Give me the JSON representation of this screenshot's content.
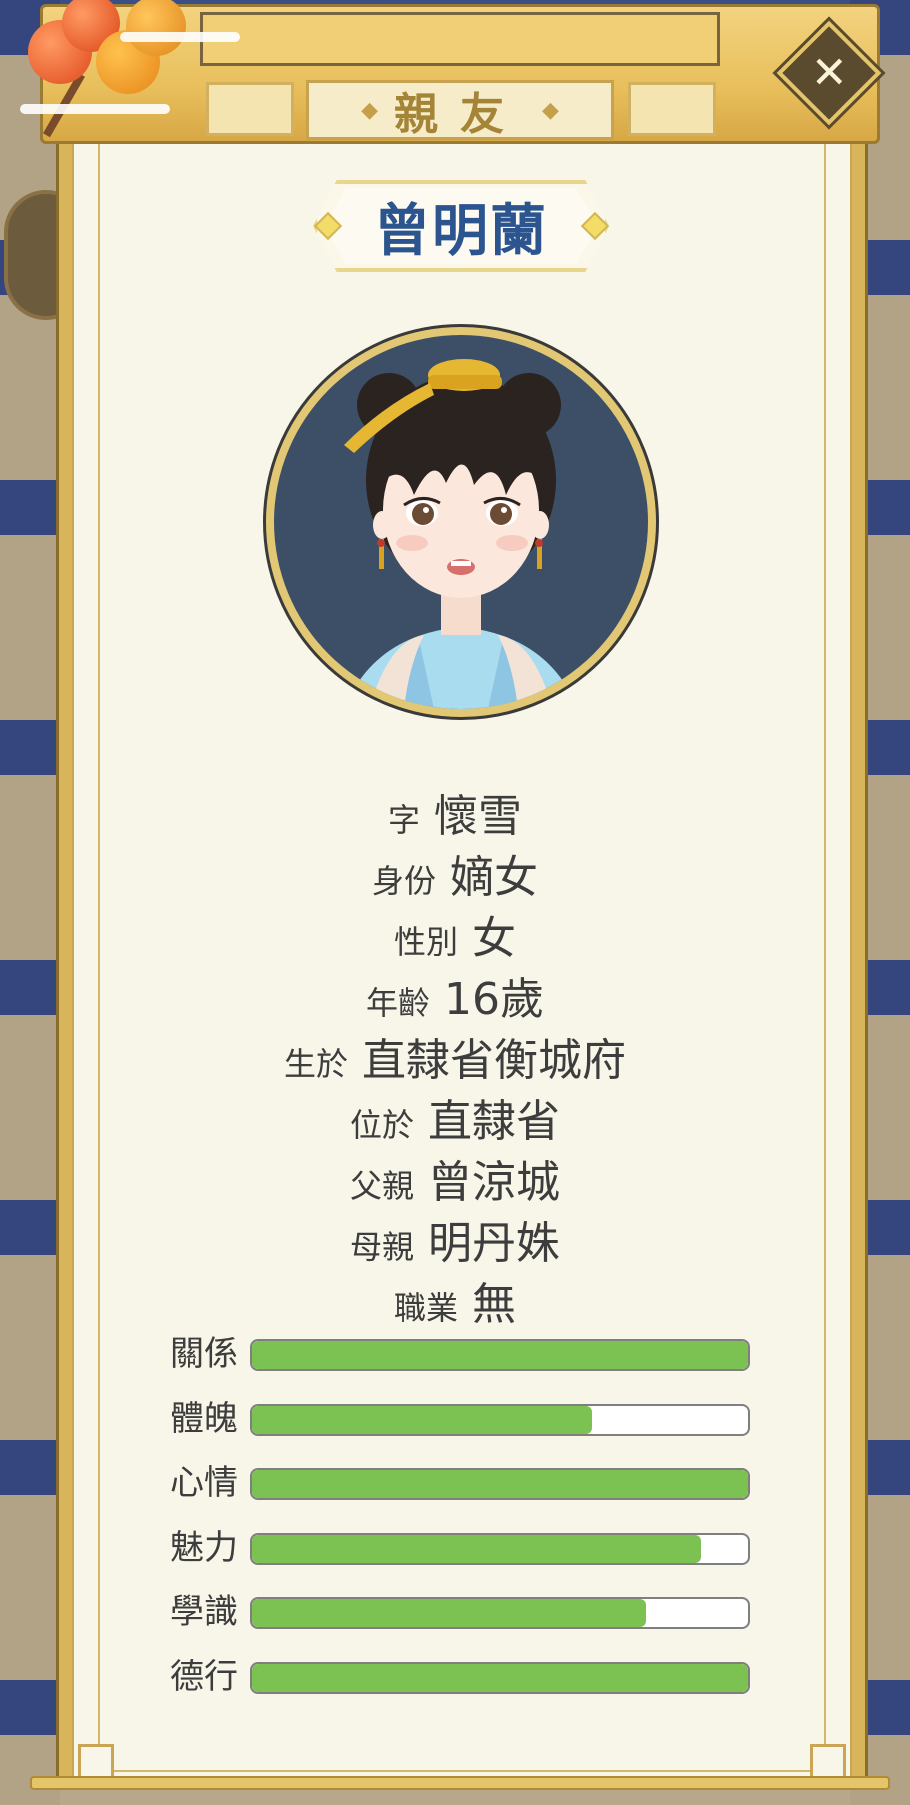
{
  "header": {
    "title": "親友",
    "close_icon": "close-icon"
  },
  "character": {
    "name": "曾明蘭",
    "portrait_icon": "character-portrait"
  },
  "info": [
    {
      "label": "字",
      "value": "懷雪"
    },
    {
      "label": "身份",
      "value": "嫡女"
    },
    {
      "label": "性別",
      "value": "女"
    },
    {
      "label": "年齡",
      "value": "16歲"
    },
    {
      "label": "生於",
      "value": "直隸省衡城府"
    },
    {
      "label": "位於",
      "value": "直隸省"
    },
    {
      "label": "父親",
      "value": "曾涼城"
    },
    {
      "label": "母親",
      "value": "明丹姝"
    },
    {
      "label": "職業",
      "value": "無"
    }
  ],
  "stats": [
    {
      "label": "關係",
      "fill": 1.0
    },
    {
      "label": "體魄",
      "fill": 0.685
    },
    {
      "label": "心情",
      "fill": 1.0
    },
    {
      "label": "魅力",
      "fill": 0.905
    },
    {
      "label": "學識",
      "fill": 0.795
    },
    {
      "label": "德行",
      "fill": 1.0
    }
  ],
  "colors": {
    "bar_fill": "#7cc252",
    "name_text": "#2c5590",
    "title_text": "#a48436",
    "parchment": "#f8f5e9",
    "gold_frame": "#d8b45a"
  }
}
